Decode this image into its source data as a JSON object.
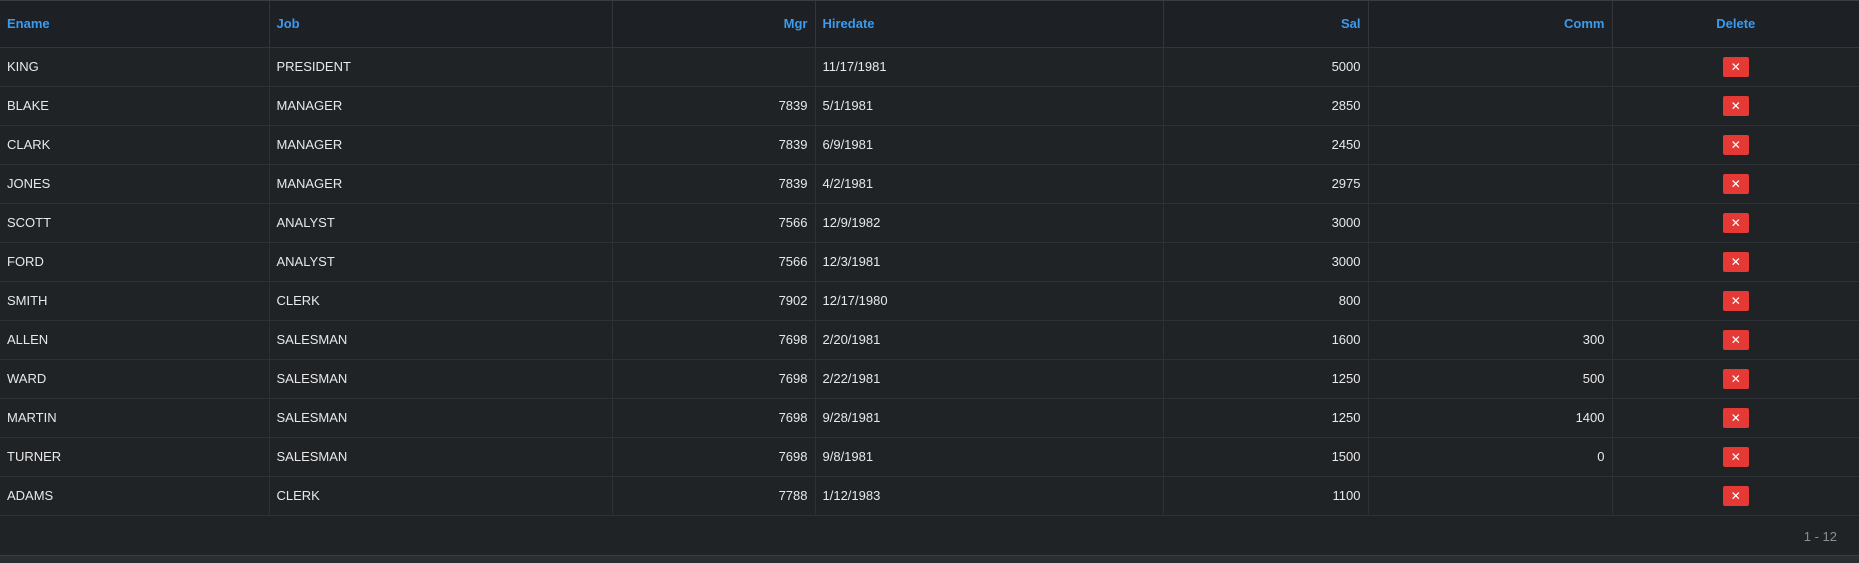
{
  "columns": {
    "ename": "Ename",
    "job": "Job",
    "mgr": "Mgr",
    "hiredate": "Hiredate",
    "sal": "Sal",
    "comm": "Comm",
    "delete": "Delete"
  },
  "rows": [
    {
      "ename": "KING",
      "job": "PRESIDENT",
      "mgr": "",
      "hiredate": "11/17/1981",
      "sal": "5000",
      "comm": ""
    },
    {
      "ename": "BLAKE",
      "job": "MANAGER",
      "mgr": "7839",
      "hiredate": "5/1/1981",
      "sal": "2850",
      "comm": ""
    },
    {
      "ename": "CLARK",
      "job": "MANAGER",
      "mgr": "7839",
      "hiredate": "6/9/1981",
      "sal": "2450",
      "comm": ""
    },
    {
      "ename": "JONES",
      "job": "MANAGER",
      "mgr": "7839",
      "hiredate": "4/2/1981",
      "sal": "2975",
      "comm": ""
    },
    {
      "ename": "SCOTT",
      "job": "ANALYST",
      "mgr": "7566",
      "hiredate": "12/9/1982",
      "sal": "3000",
      "comm": ""
    },
    {
      "ename": "FORD",
      "job": "ANALYST",
      "mgr": "7566",
      "hiredate": "12/3/1981",
      "sal": "3000",
      "comm": ""
    },
    {
      "ename": "SMITH",
      "job": "CLERK",
      "mgr": "7902",
      "hiredate": "12/17/1980",
      "sal": "800",
      "comm": ""
    },
    {
      "ename": "ALLEN",
      "job": "SALESMAN",
      "mgr": "7698",
      "hiredate": "2/20/1981",
      "sal": "1600",
      "comm": "300"
    },
    {
      "ename": "WARD",
      "job": "SALESMAN",
      "mgr": "7698",
      "hiredate": "2/22/1981",
      "sal": "1250",
      "comm": "500"
    },
    {
      "ename": "MARTIN",
      "job": "SALESMAN",
      "mgr": "7698",
      "hiredate": "9/28/1981",
      "sal": "1250",
      "comm": "1400"
    },
    {
      "ename": "TURNER",
      "job": "SALESMAN",
      "mgr": "7698",
      "hiredate": "9/8/1981",
      "sal": "1500",
      "comm": "0"
    },
    {
      "ename": "ADAMS",
      "job": "CLERK",
      "mgr": "7788",
      "hiredate": "1/12/1983",
      "sal": "1100",
      "comm": ""
    }
  ],
  "delete_button": {
    "glyph": "✕",
    "icon": "close-icon",
    "color": "#e53935"
  },
  "pager": {
    "info": "1 - 12"
  },
  "colors": {
    "background": "#202326",
    "header_text": "#3a9bf0",
    "cell_text": "#e8e8e8"
  }
}
